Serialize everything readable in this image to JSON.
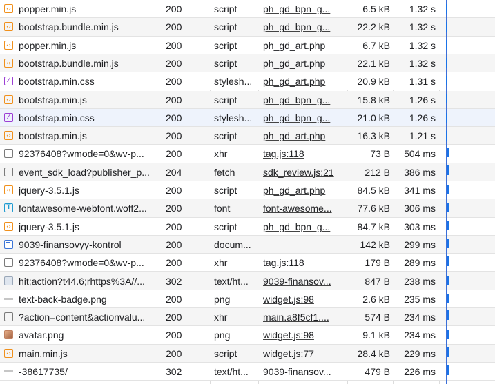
{
  "rows": [
    {
      "icon": "script-icon",
      "name": "popper.min.js",
      "status": "200",
      "type": "script",
      "initiator": "ph_gd_bpn_g...",
      "size": "6.5 kB",
      "time": "1.32 s"
    },
    {
      "icon": "script-icon",
      "name": "bootstrap.bundle.min.js",
      "status": "200",
      "type": "script",
      "initiator": "ph_gd_bpn_g...",
      "size": "22.2 kB",
      "time": "1.32 s"
    },
    {
      "icon": "script-icon",
      "name": "popper.min.js",
      "status": "200",
      "type": "script",
      "initiator": "ph_gd_art.php",
      "size": "6.7 kB",
      "time": "1.32 s"
    },
    {
      "icon": "script-icon",
      "name": "bootstrap.bundle.min.js",
      "status": "200",
      "type": "script",
      "initiator": "ph_gd_art.php",
      "size": "22.1 kB",
      "time": "1.32 s"
    },
    {
      "icon": "stylesheet-icon",
      "name": "bootstrap.min.css",
      "status": "200",
      "type": "stylesh...",
      "initiator": "ph_gd_art.php",
      "size": "20.9 kB",
      "time": "1.31 s"
    },
    {
      "icon": "script-icon",
      "name": "bootstrap.min.js",
      "status": "200",
      "type": "script",
      "initiator": "ph_gd_bpn_g...",
      "size": "15.8 kB",
      "time": "1.26 s"
    },
    {
      "icon": "stylesheet-icon",
      "name": "bootstrap.min.css",
      "status": "200",
      "type": "stylesh...",
      "initiator": "ph_gd_bpn_g...",
      "size": "21.0 kB",
      "time": "1.26 s"
    },
    {
      "icon": "script-icon",
      "name": "bootstrap.min.js",
      "status": "200",
      "type": "script",
      "initiator": "ph_gd_art.php",
      "size": "16.3 kB",
      "time": "1.21 s"
    },
    {
      "icon": "xhr-icon",
      "name": "92376408?wmode=0&wv-p...",
      "status": "200",
      "type": "xhr",
      "initiator": "tag.js:118",
      "size": "73 B",
      "time": "504 ms"
    },
    {
      "icon": "xhr-icon",
      "name": "event_sdk_load?publisher_p...",
      "status": "204",
      "type": "fetch",
      "initiator": "sdk_review.js:21",
      "size": "212 B",
      "time": "386 ms"
    },
    {
      "icon": "script-icon",
      "name": "jquery-3.5.1.js",
      "status": "200",
      "type": "script",
      "initiator": "ph_gd_art.php",
      "size": "84.5 kB",
      "time": "341 ms"
    },
    {
      "icon": "font-icon",
      "name": "fontawesome-webfont.woff2...",
      "status": "200",
      "type": "font",
      "initiator": "font-awesome...",
      "size": "77.6 kB",
      "time": "306 ms"
    },
    {
      "icon": "script-icon",
      "name": "jquery-3.5.1.js",
      "status": "200",
      "type": "script",
      "initiator": "ph_gd_bpn_g...",
      "size": "84.7 kB",
      "time": "303 ms"
    },
    {
      "icon": "document-icon",
      "name": "9039-finansovyy-kontrol",
      "status": "200",
      "type": "docum...",
      "initiator": "",
      "size": "142 kB",
      "time": "299 ms"
    },
    {
      "icon": "xhr-icon",
      "name": "92376408?wmode=0&wv-p...",
      "status": "200",
      "type": "xhr",
      "initiator": "tag.js:118",
      "size": "179 B",
      "time": "289 ms"
    },
    {
      "icon": "image-icon",
      "name": "hit;action?t44.6;rhttps%3A//...",
      "status": "302",
      "type": "text/ht...",
      "initiator": "9039-finansov...",
      "size": "847 B",
      "time": "238 ms"
    },
    {
      "icon": "badge-image-icon",
      "name": "text-back-badge.png",
      "status": "200",
      "type": "png",
      "initiator": "widget.js:98",
      "size": "2.6 kB",
      "time": "235 ms"
    },
    {
      "icon": "xhr-icon",
      "name": "?action=content&actionvalu...",
      "status": "200",
      "type": "xhr",
      "initiator": "main.a8f5cf1....",
      "size": "574 B",
      "time": "234 ms"
    },
    {
      "icon": "avatar-image-icon",
      "name": "avatar.png",
      "status": "200",
      "type": "png",
      "initiator": "widget.js:98",
      "size": "9.1 kB",
      "time": "234 ms"
    },
    {
      "icon": "script-icon",
      "name": "main.min.js",
      "status": "200",
      "type": "script",
      "initiator": "widget.js:77",
      "size": "28.4 kB",
      "time": "229 ms"
    },
    {
      "icon": "badge-image-icon",
      "name": "-38617735/",
      "status": "302",
      "type": "text/ht...",
      "initiator": "9039-finansov...",
      "size": "479 B",
      "time": "226 ms"
    }
  ],
  "colors": {
    "script": "#f0901c",
    "stylesheet": "#9c3fd4",
    "font": "#1f9bd1",
    "document": "#3a74d8",
    "waterfall_bar": "#1a73e8",
    "dom_content_loaded_line": "#3b6fd8",
    "load_line": "#d93025"
  }
}
